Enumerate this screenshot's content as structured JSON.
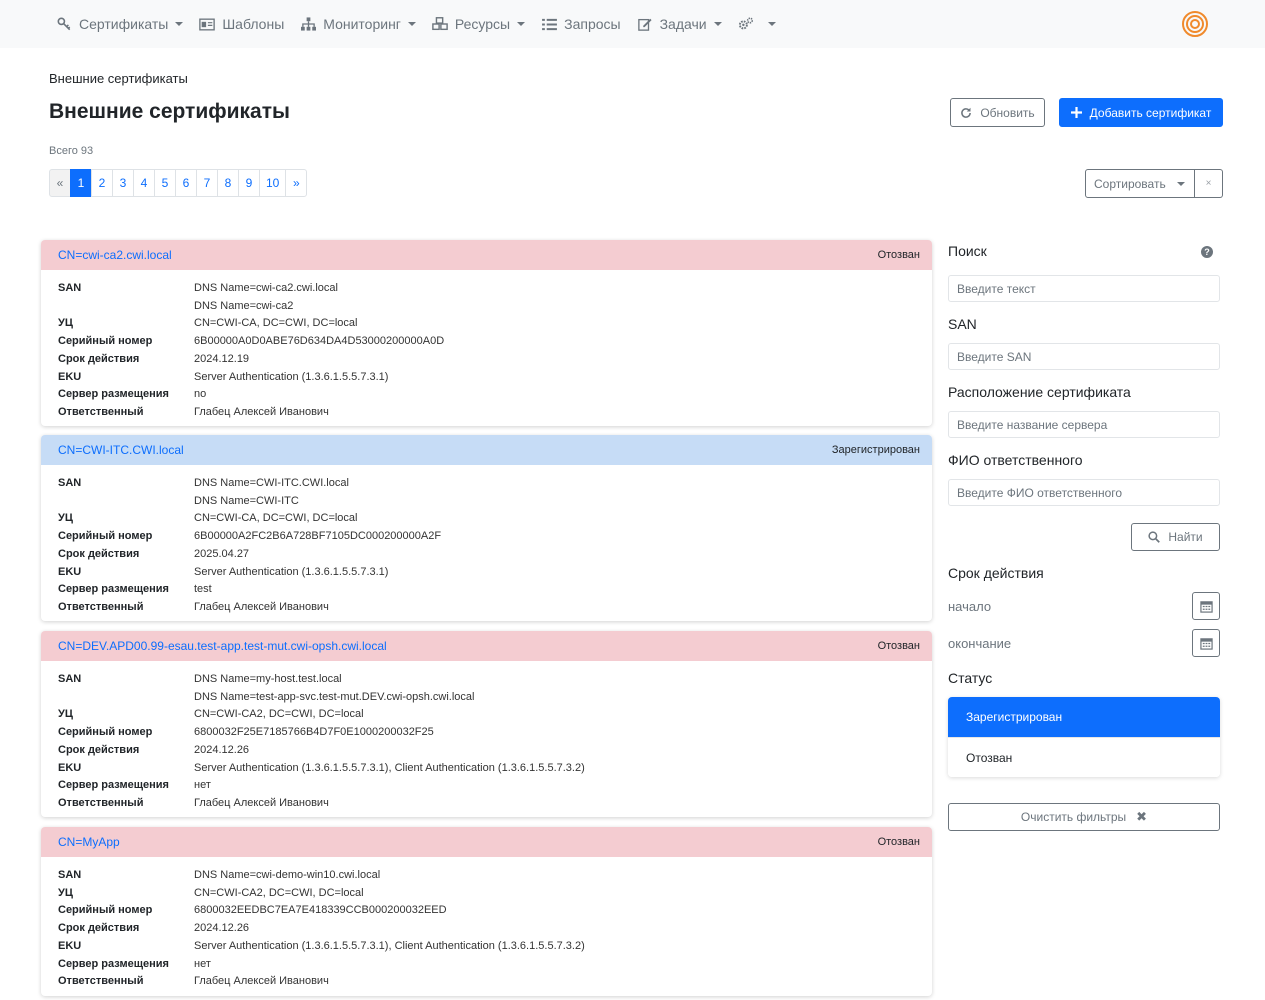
{
  "nav": {
    "items": [
      {
        "label": "Сертификаты",
        "icon": "key-icon",
        "dropdown": true
      },
      {
        "label": "Шаблоны",
        "icon": "id-card-icon",
        "dropdown": false
      },
      {
        "label": "Мониторинг",
        "icon": "sitemap-icon",
        "dropdown": true
      },
      {
        "label": "Ресурсы",
        "icon": "cubes-icon",
        "dropdown": true
      },
      {
        "label": "Запросы",
        "icon": "list-icon",
        "dropdown": false
      },
      {
        "label": "Задачи",
        "icon": "edit-icon",
        "dropdown": true
      },
      {
        "label": "",
        "icon": "cogs-icon",
        "dropdown": true
      }
    ]
  },
  "breadcrumb": "Внешние сертификаты",
  "page_title": "Внешние сертификаты",
  "buttons": {
    "refresh": "Обновить",
    "add": "Добавить сертификат",
    "sort": "Сортировать",
    "sort_clear": "×",
    "find": "Найти",
    "clear_filters": "Очистить фильтры"
  },
  "total": "Всего 93",
  "pagination": {
    "prev": "«",
    "pages": [
      "1",
      "2",
      "3",
      "4",
      "5",
      "6",
      "7",
      "8",
      "9",
      "10"
    ],
    "active": "1",
    "next": "»"
  },
  "certificates": [
    {
      "cn": "CN=cwi-ca2.cwi.local",
      "status": "Отозван",
      "state": "revoked",
      "fields": [
        {
          "k": "SAN",
          "v": "DNS Name=cwi-ca2.cwi.local"
        },
        {
          "k": "",
          "v": "DNS Name=cwi-ca2"
        },
        {
          "k": "УЦ",
          "v": "CN=CWI-CA, DC=CWI, DC=local"
        },
        {
          "k": "Серийный номер",
          "v": "6B00000A0D0ABE76D634DA4D53000200000A0D"
        },
        {
          "k": "Срок действия",
          "v": "2024.12.19"
        },
        {
          "k": "EKU",
          "v": "Server Authentication (1.3.6.1.5.5.7.3.1)"
        },
        {
          "k": "Сервер размещения",
          "v": "no"
        },
        {
          "k": "Ответственный",
          "v": "Глабец Алексей Иванович"
        }
      ]
    },
    {
      "cn": "CN=CWI-ITC.CWI.local",
      "status": "Зарегистрирован",
      "state": "registered",
      "fields": [
        {
          "k": "SAN",
          "v": "DNS Name=CWI-ITC.CWI.local"
        },
        {
          "k": "",
          "v": "DNS Name=CWI-ITC"
        },
        {
          "k": "УЦ",
          "v": "CN=CWI-CA, DC=CWI, DC=local"
        },
        {
          "k": "Серийный номер",
          "v": "6B00000A2FC2B6A728BF7105DC000200000A2F"
        },
        {
          "k": "Срок действия",
          "v": "2025.04.27"
        },
        {
          "k": "EKU",
          "v": "Server Authentication (1.3.6.1.5.5.7.3.1)"
        },
        {
          "k": "Сервер размещения",
          "v": "test"
        },
        {
          "k": "Ответственный",
          "v": "Глабец Алексей Иванович"
        }
      ]
    },
    {
      "cn": "CN=DEV.APD00.99-esau.test-app.test-mut.cwi-opsh.cwi.local",
      "status": "Отозван",
      "state": "revoked",
      "fields": [
        {
          "k": "SAN",
          "v": "DNS Name=my-host.test.local"
        },
        {
          "k": "",
          "v": "DNS Name=test-app-svc.test-mut.DEV.cwi-opsh.cwi.local"
        },
        {
          "k": "УЦ",
          "v": "CN=CWI-CA2, DC=CWI, DC=local"
        },
        {
          "k": "Серийный номер",
          "v": "6800032F25E7185766B4D7F0E1000200032F25"
        },
        {
          "k": "Срок действия",
          "v": "2024.12.26"
        },
        {
          "k": "EKU",
          "v": "Server Authentication (1.3.6.1.5.5.7.3.1), Client Authentication (1.3.6.1.5.5.7.3.2)"
        },
        {
          "k": "Сервер размещения",
          "v": "нет"
        },
        {
          "k": "Ответственный",
          "v": "Глабец Алексей Иванович"
        }
      ]
    },
    {
      "cn": "CN=MyApp",
      "status": "Отозван",
      "state": "revoked",
      "fields": [
        {
          "k": "SAN",
          "v": "DNS Name=cwi-demo-win10.cwi.local"
        },
        {
          "k": "УЦ",
          "v": "CN=CWI-CA2, DC=CWI, DC=local"
        },
        {
          "k": "Серийный номер",
          "v": "6800032EEDBC7EA7E418339CCB000200032EED"
        },
        {
          "k": "Срок действия",
          "v": "2024.12.26"
        },
        {
          "k": "EKU",
          "v": "Server Authentication (1.3.6.1.5.5.7.3.1), Client Authentication (1.3.6.1.5.5.7.3.2)"
        },
        {
          "k": "Сервер размещения",
          "v": "нет"
        },
        {
          "k": "Ответственный",
          "v": "Глабец Алексей Иванович"
        }
      ]
    }
  ],
  "sidebar": {
    "search_label": "Поиск",
    "search_placeholder": "Введите текст",
    "san_label": "SAN",
    "san_placeholder": "Введите SAN",
    "location_label": "Расположение сертификата",
    "location_placeholder": "Введите название сервера",
    "owner_label": "ФИО ответственного",
    "owner_placeholder": "Введите ФИО ответственного",
    "validity_label": "Срок действия",
    "start_label": "начало",
    "end_label": "окончание",
    "status_label": "Статус",
    "status_options": [
      "Зарегистрирован",
      "Отозван"
    ],
    "status_selected": "Зарегистрирован"
  },
  "colors": {
    "primary": "#0d6efd",
    "revoked_header": "#f4ccd1",
    "registered_header": "#c6dcf6",
    "logo": "#f08a2c"
  }
}
